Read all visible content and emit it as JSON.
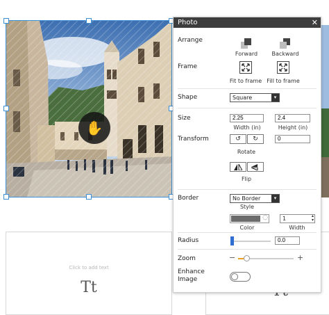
{
  "panel": {
    "title": "Photo",
    "close_icon": "close-icon",
    "arrange": {
      "label": "Arrange",
      "forward_label": "Forward",
      "backward_label": "Backward"
    },
    "frame": {
      "label": "Frame",
      "fit_to_frame_label": "Fit to frame",
      "fill_to_frame_label": "Fill to frame"
    },
    "shape": {
      "label": "Shape",
      "value": "Square"
    },
    "size": {
      "label": "Size",
      "width_value": "2.25",
      "height_value": "2.4",
      "width_caption": "Width (in)",
      "height_caption": "Height (in)"
    },
    "transform": {
      "label": "Transform",
      "rotate_caption": "Rotate",
      "rotate_value": "0",
      "flip_caption": "Flip"
    },
    "border": {
      "label": "Border",
      "style_value": "No Border",
      "style_caption": "Style",
      "color_caption": "Color",
      "color_value": "#6b6b6b",
      "width_value": "1",
      "width_caption": "Width"
    },
    "radius": {
      "label": "Radius",
      "value": "0.0",
      "slider_fraction": 0.0
    },
    "zoom": {
      "label": "Zoom",
      "minus": "−",
      "plus": "+",
      "slider_fraction": 0.15
    },
    "enhance": {
      "label_line1": "Enhance",
      "label_line2": "Image",
      "enabled": false
    }
  },
  "canvas": {
    "text_placeholder": "Click to add text",
    "text_icon": "Tt",
    "selection_color": "#3a8fd6",
    "move_cursor_icon": "hand-grab-icon",
    "delete_icon": "trash-icon"
  }
}
